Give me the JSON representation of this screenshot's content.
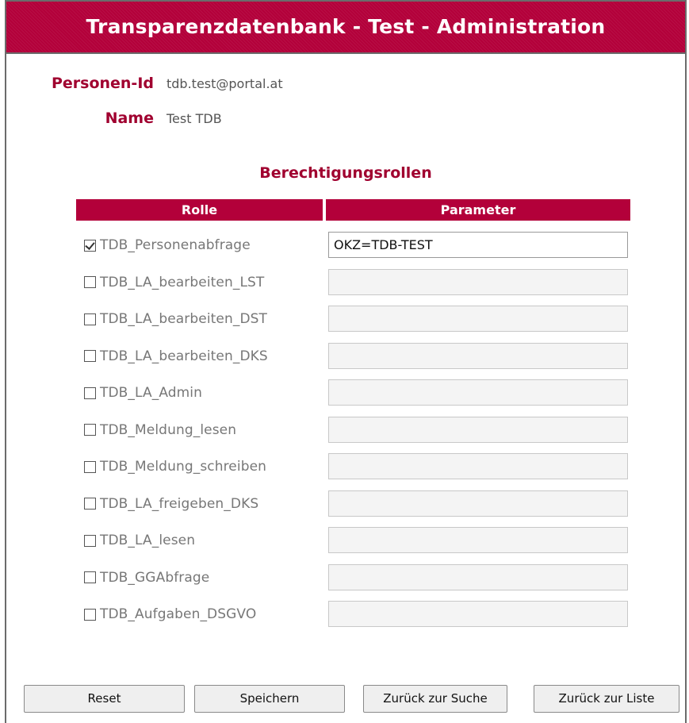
{
  "header": {
    "title": "Transparenzdatenbank - Test - Administration"
  },
  "person": {
    "id_label": "Personen-Id",
    "id_value": "tdb.test@portal.at",
    "name_label": "Name",
    "name_value": "Test TDB"
  },
  "roles_section": {
    "title": "Berechtigungsrollen",
    "col_role": "Rolle",
    "col_param": "Parameter",
    "rows": [
      {
        "label": "TDB_Personenabfrage",
        "checked": true,
        "param": "OKZ=TDB-TEST"
      },
      {
        "label": "TDB_LA_bearbeiten_LST",
        "checked": false,
        "param": ""
      },
      {
        "label": "TDB_LA_bearbeiten_DST",
        "checked": false,
        "param": ""
      },
      {
        "label": "TDB_LA_bearbeiten_DKS",
        "checked": false,
        "param": ""
      },
      {
        "label": "TDB_LA_Admin",
        "checked": false,
        "param": ""
      },
      {
        "label": "TDB_Meldung_lesen",
        "checked": false,
        "param": ""
      },
      {
        "label": "TDB_Meldung_schreiben",
        "checked": false,
        "param": ""
      },
      {
        "label": "TDB_LA_freigeben_DKS",
        "checked": false,
        "param": ""
      },
      {
        "label": "TDB_LA_lesen",
        "checked": false,
        "param": ""
      },
      {
        "label": "TDB_GGAbfrage",
        "checked": false,
        "param": ""
      },
      {
        "label": "TDB_Aufgaben_DSGVO",
        "checked": false,
        "param": ""
      }
    ]
  },
  "buttons": {
    "reset": "Reset",
    "save": "Speichern",
    "back_search": "Zurück zur Suche",
    "back_list": "Zurück zur Liste"
  },
  "colors": {
    "accent": "#b3003a",
    "label": "#a0002f"
  }
}
